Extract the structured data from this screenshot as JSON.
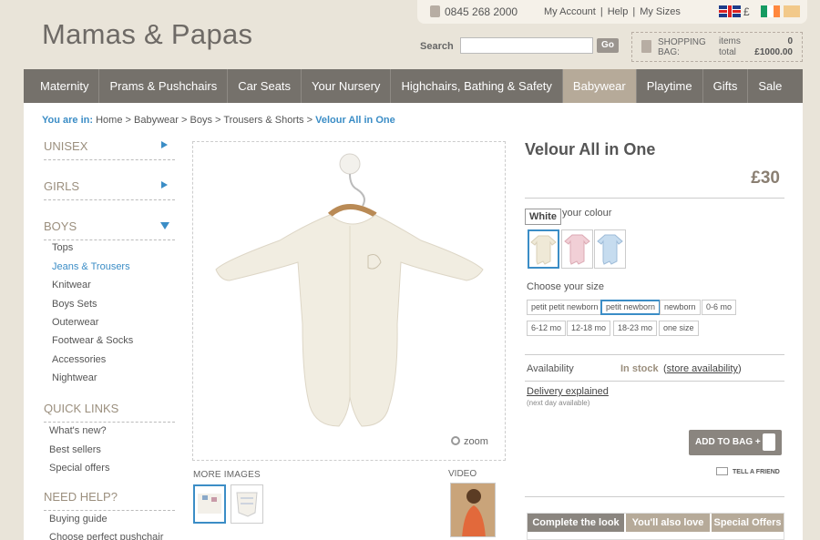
{
  "brand": {
    "logo": "Mamas & Papas"
  },
  "topbar": {
    "phone": "0845 268 2000",
    "links": [
      "My Account",
      "Help",
      "My Sizes"
    ],
    "currency": "£"
  },
  "search": {
    "label": "Search",
    "button": "Go",
    "value": ""
  },
  "bag": {
    "title": "SHOPPING BAG:",
    "items_label": "items",
    "total_label": "total",
    "items": "0",
    "total": "£1000.00"
  },
  "nav": {
    "items": [
      "Maternity",
      "Prams & Pushchairs",
      "Car Seats",
      "Your Nursery",
      "Highchairs, Bathing & Safety",
      "Babywear",
      "Playtime",
      "Gifts",
      "Sale"
    ],
    "active": "Babywear"
  },
  "breadcrumb": {
    "prefix": "You are in:",
    "path": [
      "Home",
      "Babywear",
      "Boys",
      "Trousers & Shorts"
    ],
    "separator": ">",
    "current": "Velour All in One"
  },
  "sidebar": {
    "categories": [
      "UNISEX",
      "GIRLS",
      "BOYS"
    ],
    "boys_items": [
      "Tops",
      "Jeans & Trousers",
      "Knitwear",
      "Boys Sets",
      "Outerwear",
      "Footwear & Socks",
      "Accessories",
      "Nightwear"
    ],
    "active_item": "Jeans & Trousers",
    "quick_links_title": "QUICK LINKS",
    "quick_links": [
      "What's new?",
      "Best sellers",
      "Special offers"
    ],
    "help_title": "NEED HELP?",
    "help_links": [
      "Buying guide",
      "Choose perfect pushchair"
    ]
  },
  "gallery": {
    "zoom": "zoom",
    "more_images": "MORE IMAGES",
    "video": "VIDEO"
  },
  "product": {
    "title": "Velour All in One",
    "price": "£30",
    "colour_tooltip": "White",
    "colour_label": "your colour",
    "colours": [
      "White",
      "Pink",
      "Blue"
    ],
    "size_label": "Choose your size",
    "sizes": [
      "petit petit newborn",
      "petit newborn",
      "newborn",
      "0-6 mo",
      "6-12 mo",
      "12-18 mo",
      "18-23 mo",
      "one size"
    ],
    "selected_size": "petit newborn",
    "availability_label": "Availability",
    "availability": "In stock",
    "store_link": "store availability",
    "delivery_link": "Delivery explained",
    "delivery_note": "(next day available)",
    "add_to_bag": "ADD TO BAG +",
    "tell_friend": "TELL A FRIEND"
  },
  "tabs": [
    "Complete the look",
    "You'll also love",
    "Special Offers"
  ],
  "colors": {
    "accent": "#3b8dc6",
    "nav": "#75716b",
    "nav_active": "#b6aa99",
    "tab": "#b6aa99",
    "tab_active": "#8a857f"
  }
}
